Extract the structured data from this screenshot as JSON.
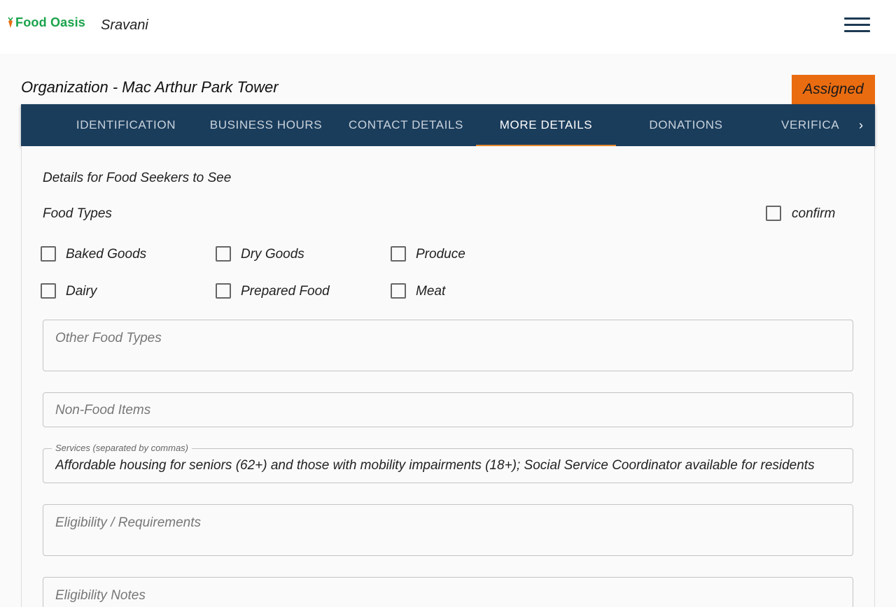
{
  "header": {
    "logo_text": "Food Oasis",
    "username": "Sravani"
  },
  "organization": {
    "title": "Organization - Mac Arthur Park Tower",
    "status": "Assigned"
  },
  "tabs": [
    {
      "label": "Identification"
    },
    {
      "label": "Business Hours"
    },
    {
      "label": "Contact Details"
    },
    {
      "label": "More Details"
    },
    {
      "label": "Donations"
    },
    {
      "label": "Verifica"
    }
  ],
  "tab_scroll_icon": "chevron-right-icon",
  "section": {
    "title": "Details for Food Seekers to See",
    "food_types_label": "Food Types",
    "confirm_label": "confirm"
  },
  "food_types": [
    {
      "label": "Baked Goods"
    },
    {
      "label": "Dry Goods"
    },
    {
      "label": "Produce"
    },
    {
      "label": "Dairy"
    },
    {
      "label": "Prepared Food"
    },
    {
      "label": "Meat"
    }
  ],
  "fields": {
    "other_food_types": {
      "placeholder": "Other Food Types"
    },
    "non_food_items": {
      "placeholder": "Non-Food Items"
    },
    "services": {
      "label": "Services (separated by commas)",
      "value": "Affordable housing for seniors (62+) and those with mobility impairments (18+); Social Service Coordinator available for residents"
    },
    "eligibility": {
      "placeholder": "Eligibility / Requirements"
    },
    "eligibility_notes": {
      "placeholder": "Eligibility Notes"
    }
  },
  "colors": {
    "brand_green": "#19a34a",
    "tabbar_bg": "#1b3d5c",
    "status_orange": "#ea6c10",
    "tab_indicator": "#e58a2e"
  }
}
